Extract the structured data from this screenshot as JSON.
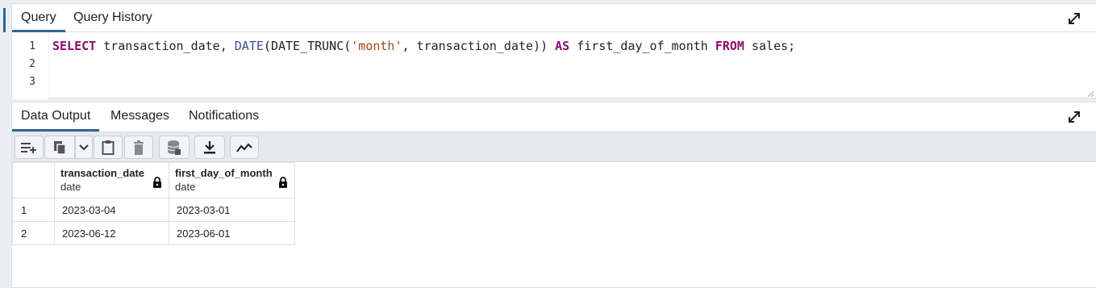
{
  "query_tabs": [
    {
      "label": "Query",
      "active": true
    },
    {
      "label": "Query History",
      "active": false
    }
  ],
  "editor": {
    "line_numbers": [
      "1",
      "2",
      "3"
    ],
    "tokens": {
      "select": "SELECT",
      "col1": " transaction_date, ",
      "date_fn": "DATE",
      "paren_open": "(",
      "trunc_fn": "DATE_TRUNC",
      "paren_open2": "(",
      "month_str": "'month'",
      "comma_col": ", transaction_date",
      "paren_close": "))",
      "as_kw": "AS",
      "alias": " first_day_of_month ",
      "from_kw": "FROM",
      "table": " sales;"
    }
  },
  "output_tabs": [
    {
      "label": "Data Output",
      "active": true
    },
    {
      "label": "Messages",
      "active": false
    },
    {
      "label": "Notifications",
      "active": false
    }
  ],
  "toolbar": {
    "icons": [
      "add-row-icon",
      "copy-icon",
      "dropdown-chevron-icon",
      "paste-icon",
      "delete-icon",
      "save-data-icon",
      "download-icon",
      "graph-icon"
    ]
  },
  "grid": {
    "columns": [
      {
        "name": "transaction_date",
        "type": "date"
      },
      {
        "name": "first_day_of_month",
        "type": "date"
      }
    ],
    "rows": [
      {
        "num": "1",
        "cells": [
          "2023-03-04",
          "2023-03-01"
        ]
      },
      {
        "num": "2",
        "cells": [
          "2023-06-12",
          "2023-06-01"
        ]
      }
    ]
  }
}
